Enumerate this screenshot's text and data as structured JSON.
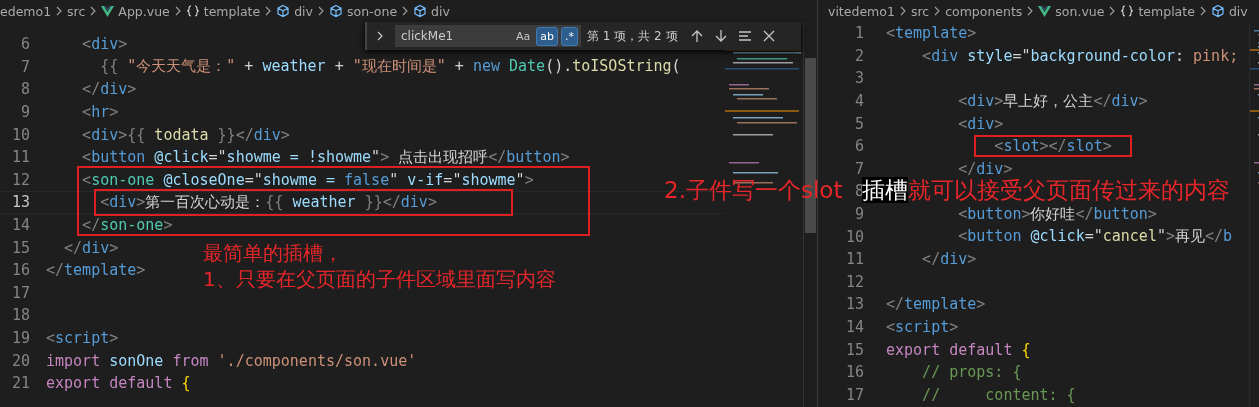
{
  "left_editor": {
    "breadcrumbs": [
      {
        "kind": "folder",
        "label": "edemo1"
      },
      {
        "kind": "folder",
        "label": "src"
      },
      {
        "kind": "vue",
        "label": "App.vue"
      },
      {
        "kind": "braces",
        "label": "template"
      },
      {
        "kind": "element",
        "label": "div"
      },
      {
        "kind": "element",
        "label": "son-one"
      },
      {
        "kind": "element",
        "label": "div"
      }
    ],
    "find_widget": {
      "value": "clickMe1",
      "toggles": [
        {
          "label": "Aa",
          "on": false
        },
        {
          "label": "ab",
          "on": true
        },
        {
          "label": ".*",
          "on": true
        }
      ],
      "result": "第 1 项，共 2 项"
    },
    "lines": [
      {
        "n": "6",
        "current": false,
        "tokens": [
          {
            "kind": "punct",
            "text": "    <"
          },
          {
            "kind": "tag",
            "text": "div"
          },
          {
            "kind": "punct",
            "text": ">"
          }
        ]
      },
      {
        "n": "7",
        "current": false,
        "tokens": [
          {
            "kind": "punct",
            "text": "      {{ "
          },
          {
            "kind": "str",
            "text": "\"今天天气是：\""
          },
          {
            "kind": "text",
            "text": " + "
          },
          {
            "kind": "var",
            "text": "weather"
          },
          {
            "kind": "text",
            "text": " + "
          },
          {
            "kind": "str",
            "text": "\"现在时间是\""
          },
          {
            "kind": "text",
            "text": " + "
          },
          {
            "kind": "const",
            "text": "new"
          },
          {
            "kind": "cls",
            "text": " Date"
          },
          {
            "kind": "text",
            "text": "()."
          },
          {
            "kind": "fn",
            "text": "toISOString"
          },
          {
            "kind": "text",
            "text": "("
          }
        ]
      },
      {
        "n": "8",
        "current": false,
        "tokens": [
          {
            "kind": "punct",
            "text": "    </"
          },
          {
            "kind": "tag",
            "text": "div"
          },
          {
            "kind": "punct",
            "text": ">"
          }
        ]
      },
      {
        "n": "9",
        "current": false,
        "tokens": [
          {
            "kind": "punct",
            "text": "    <"
          },
          {
            "kind": "tag",
            "text": "hr"
          },
          {
            "kind": "punct",
            "text": ">"
          }
        ]
      },
      {
        "n": "10",
        "current": false,
        "tokens": [
          {
            "kind": "punct",
            "text": "    <"
          },
          {
            "kind": "tag",
            "text": "div"
          },
          {
            "kind": "punct",
            "text": ">{{ "
          },
          {
            "kind": "fn",
            "text": "todata"
          },
          {
            "kind": "punct",
            "text": " }}</"
          },
          {
            "kind": "tag",
            "text": "div"
          },
          {
            "kind": "punct",
            "text": ">"
          }
        ]
      },
      {
        "n": "11",
        "current": false,
        "tokens": [
          {
            "kind": "punct",
            "text": "    <"
          },
          {
            "kind": "tag",
            "text": "button"
          },
          {
            "kind": "attr",
            "text": " @click"
          },
          {
            "kind": "text",
            "text": "=\""
          },
          {
            "kind": "attr",
            "text": "showme = !showme"
          },
          {
            "kind": "text",
            "text": "\""
          },
          {
            "kind": "punct",
            "text": ">"
          },
          {
            "kind": "text",
            "text": " 点击出现招呼"
          },
          {
            "kind": "punct",
            "text": "</"
          },
          {
            "kind": "tag",
            "text": "button"
          },
          {
            "kind": "punct",
            "text": ">"
          }
        ]
      },
      {
        "n": "12",
        "current": false,
        "tokens": [
          {
            "kind": "punct",
            "text": "    <"
          },
          {
            "kind": "comp",
            "text": "son-one"
          },
          {
            "kind": "attr",
            "text": " @closeOne"
          },
          {
            "kind": "text",
            "text": "=\""
          },
          {
            "kind": "attr",
            "text": "showme = "
          },
          {
            "kind": "const",
            "text": "false"
          },
          {
            "kind": "text",
            "text": "\" "
          },
          {
            "kind": "attr",
            "text": "v-if"
          },
          {
            "kind": "text",
            "text": "=\""
          },
          {
            "kind": "attr",
            "text": "showme"
          },
          {
            "kind": "text",
            "text": "\""
          },
          {
            "kind": "punct",
            "text": ">"
          }
        ]
      },
      {
        "n": "13",
        "current": true,
        "tokens": [
          {
            "kind": "punct",
            "text": "      <"
          },
          {
            "kind": "tag",
            "text": "div"
          },
          {
            "kind": "punct",
            "text": ">"
          },
          {
            "kind": "text",
            "text": "第一百次心动是："
          },
          {
            "kind": "punct",
            "text": "{{ "
          },
          {
            "kind": "var",
            "text": "weather"
          },
          {
            "kind": "punct",
            "text": " }}</"
          },
          {
            "kind": "tag",
            "text": "div"
          },
          {
            "kind": "punct",
            "text": ">"
          }
        ]
      },
      {
        "n": "14",
        "current": false,
        "tokens": [
          {
            "kind": "punct",
            "text": "    </"
          },
          {
            "kind": "comp",
            "text": "son-one"
          },
          {
            "kind": "punct",
            "text": ">"
          }
        ]
      },
      {
        "n": "15",
        "current": false,
        "tokens": [
          {
            "kind": "punct",
            "text": "  </"
          },
          {
            "kind": "tag",
            "text": "div"
          },
          {
            "kind": "punct",
            "text": ">"
          }
        ]
      },
      {
        "n": "16",
        "current": false,
        "tokens": [
          {
            "kind": "punct",
            "text": "</"
          },
          {
            "kind": "tag",
            "text": "template"
          },
          {
            "kind": "punct",
            "text": ">"
          }
        ]
      },
      {
        "n": "17",
        "current": false
      },
      {
        "n": "18",
        "current": false
      },
      {
        "n": "19",
        "current": false,
        "tokens": [
          {
            "kind": "punct",
            "text": "<"
          },
          {
            "kind": "tag",
            "text": "script"
          },
          {
            "kind": "punct",
            "text": ">"
          }
        ]
      },
      {
        "n": "20",
        "current": false,
        "tokens": [
          {
            "kind": "kw",
            "text": "import"
          },
          {
            "kind": "var",
            "text": " sonOne"
          },
          {
            "kind": "kw",
            "text": " from"
          },
          {
            "kind": "str",
            "text": " './components/son.vue'"
          }
        ]
      },
      {
        "n": "21",
        "current": false,
        "tokens": [
          {
            "kind": "kw",
            "text": "export"
          },
          {
            "kind": "kw",
            "text": " default"
          },
          {
            "kind": "brace",
            "text": " {"
          }
        ]
      }
    ],
    "annotation": [
      "最简单的插槽，",
      "1、只要在父页面的子件区域里面写内容"
    ]
  },
  "right_editor": {
    "breadcrumbs": [
      {
        "kind": "folder",
        "label": "vitedemo1"
      },
      {
        "kind": "folder",
        "label": "src"
      },
      {
        "kind": "folder",
        "label": "components"
      },
      {
        "kind": "vue",
        "label": "son.vue"
      },
      {
        "kind": "braces",
        "label": "template"
      },
      {
        "kind": "element",
        "label": "div"
      }
    ],
    "lines": [
      {
        "n": "1",
        "current": false,
        "tokens": [
          {
            "kind": "punct",
            "text": "<"
          },
          {
            "kind": "tag",
            "text": "template"
          },
          {
            "kind": "punct",
            "text": ">"
          }
        ]
      },
      {
        "n": "2",
        "current": false,
        "tokens": [
          {
            "kind": "punct",
            "text": "    <"
          },
          {
            "kind": "tag",
            "text": "div"
          },
          {
            "kind": "attr",
            "text": " style"
          },
          {
            "kind": "text",
            "text": "=\""
          },
          {
            "kind": "attr",
            "text": "background-color"
          },
          {
            "kind": "text",
            "text": ": "
          },
          {
            "kind": "str",
            "text": "pink;"
          }
        ]
      },
      {
        "n": "3",
        "current": false
      },
      {
        "n": "4",
        "current": false,
        "tokens": [
          {
            "kind": "punct",
            "text": "        <"
          },
          {
            "kind": "tag",
            "text": "div"
          },
          {
            "kind": "punct",
            "text": ">"
          },
          {
            "kind": "text",
            "text": "早上好，公主"
          },
          {
            "kind": "punct",
            "text": "</"
          },
          {
            "kind": "tag",
            "text": "div"
          },
          {
            "kind": "punct",
            "text": ">"
          }
        ]
      },
      {
        "n": "5",
        "current": false,
        "tokens": [
          {
            "kind": "punct",
            "text": "        <"
          },
          {
            "kind": "tag",
            "text": "div"
          },
          {
            "kind": "punct",
            "text": ">"
          }
        ]
      },
      {
        "n": "6",
        "current": false,
        "tokens": [
          {
            "kind": "punct",
            "text": "            <"
          },
          {
            "kind": "tag",
            "text": "slot"
          },
          {
            "kind": "punct",
            "text": "></"
          },
          {
            "kind": "tag",
            "text": "slot"
          },
          {
            "kind": "punct",
            "text": ">"
          }
        ]
      },
      {
        "n": "7",
        "current": false,
        "tokens": [
          {
            "kind": "punct",
            "text": "        </"
          },
          {
            "kind": "tag",
            "text": "div"
          },
          {
            "kind": "punct",
            "text": ">"
          }
        ]
      },
      {
        "n": "8",
        "current": false
      },
      {
        "n": "9",
        "current": false,
        "tokens": [
          {
            "kind": "punct",
            "text": "        <"
          },
          {
            "kind": "tag",
            "text": "button"
          },
          {
            "kind": "punct",
            "text": ">"
          },
          {
            "kind": "text",
            "text": "你好哇"
          },
          {
            "kind": "punct",
            "text": "</"
          },
          {
            "kind": "tag",
            "text": "button"
          },
          {
            "kind": "punct",
            "text": ">"
          }
        ]
      },
      {
        "n": "10",
        "current": false,
        "tokens": [
          {
            "kind": "punct",
            "text": "        <"
          },
          {
            "kind": "tag",
            "text": "button"
          },
          {
            "kind": "attr",
            "text": " @click"
          },
          {
            "kind": "text",
            "text": "=\""
          },
          {
            "kind": "fn",
            "text": "cancel"
          },
          {
            "kind": "text",
            "text": "\""
          },
          {
            "kind": "punct",
            "text": ">"
          },
          {
            "kind": "text",
            "text": "再见"
          },
          {
            "kind": "punct",
            "text": "</"
          },
          {
            "kind": "tag",
            "text": "b"
          }
        ]
      },
      {
        "n": "11",
        "current": false,
        "tokens": [
          {
            "kind": "punct",
            "text": "    </"
          },
          {
            "kind": "tag",
            "text": "div"
          },
          {
            "kind": "punct",
            "text": ">"
          }
        ]
      },
      {
        "n": "12",
        "current": false
      },
      {
        "n": "13",
        "current": false,
        "tokens": [
          {
            "kind": "punct",
            "text": "</"
          },
          {
            "kind": "tag",
            "text": "template"
          },
          {
            "kind": "punct",
            "text": ">"
          }
        ]
      },
      {
        "n": "14",
        "current": false,
        "tokens": [
          {
            "kind": "punct",
            "text": "<"
          },
          {
            "kind": "tag",
            "text": "script"
          },
          {
            "kind": "punct",
            "text": ">"
          }
        ]
      },
      {
        "n": "15",
        "current": false,
        "tokens": [
          {
            "kind": "kw",
            "text": "export"
          },
          {
            "kind": "kw",
            "text": " default"
          },
          {
            "kind": "brace",
            "text": " {"
          }
        ]
      },
      {
        "n": "16",
        "current": false,
        "tokens": [
          {
            "kind": "comment",
            "text": "    // props: {"
          }
        ]
      },
      {
        "n": "17",
        "current": false,
        "tokens": [
          {
            "kind": "comment",
            "text": "    //     content: {"
          }
        ]
      }
    ]
  },
  "callout": {
    "parts": [
      {
        "text": "2.子件写一个slot",
        "highlight": false
      },
      {
        "text": "插槽",
        "highlight": true
      },
      {
        "text": "就可以接受父页面传过来的内容",
        "highlight": false
      }
    ]
  }
}
